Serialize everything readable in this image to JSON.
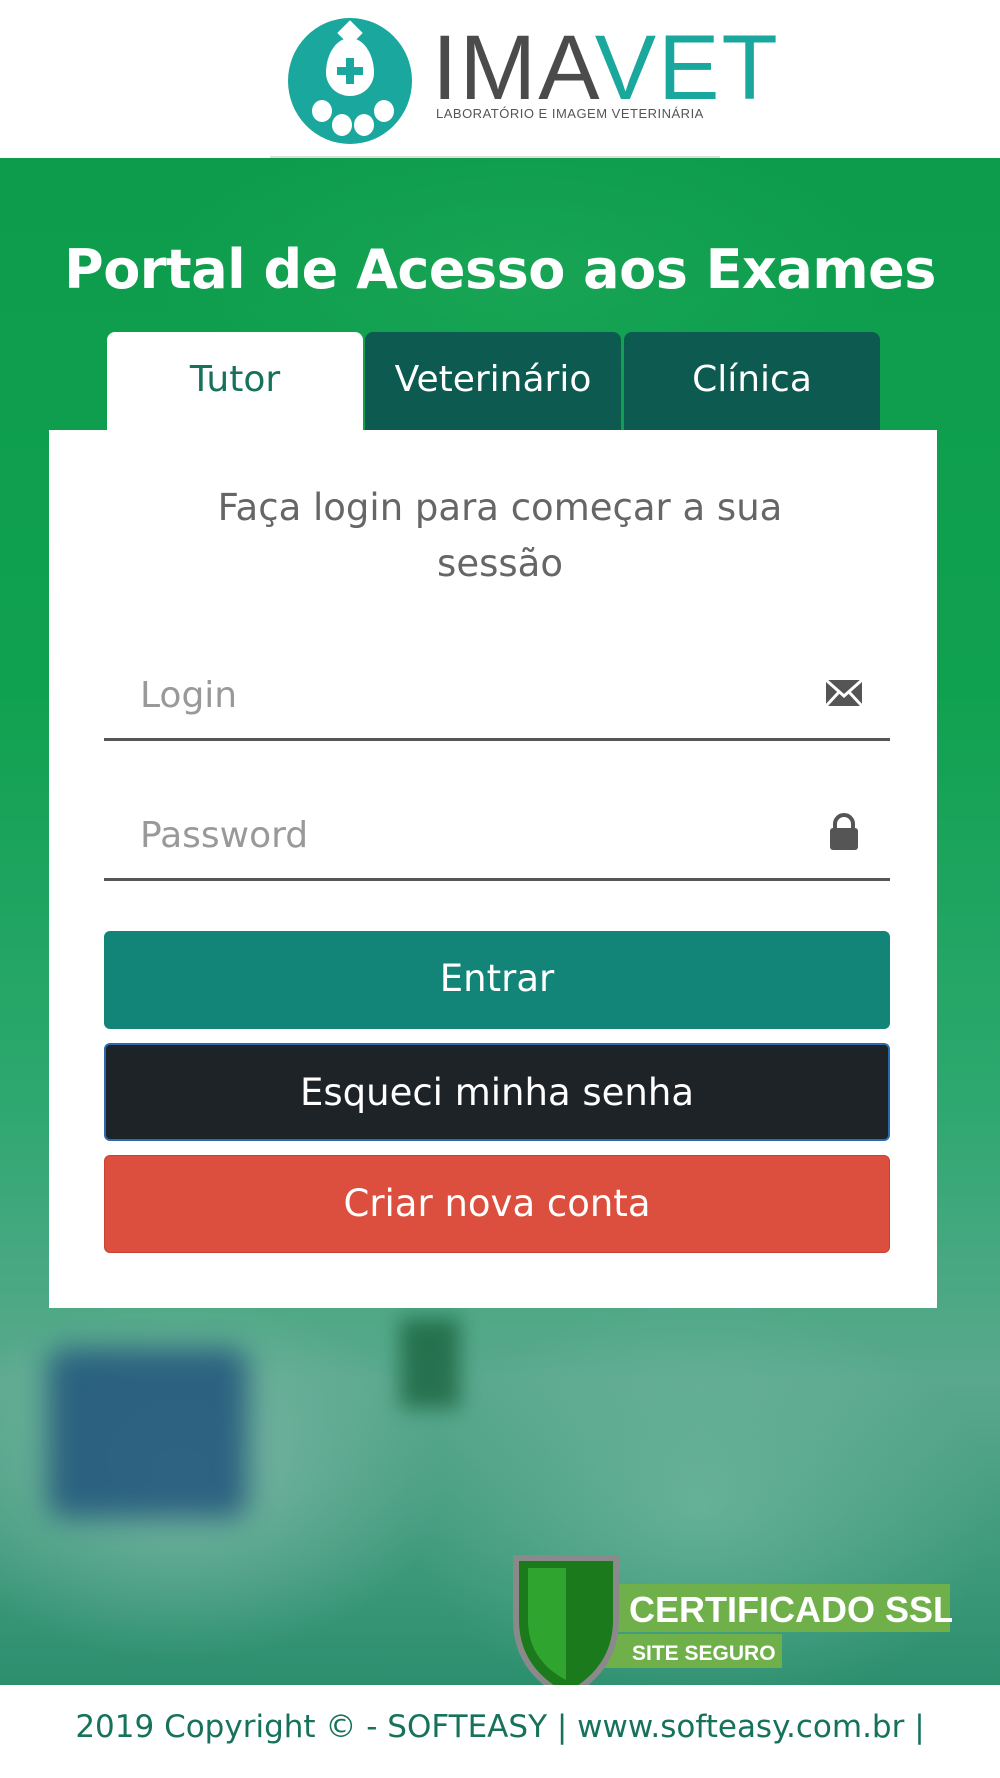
{
  "brand": {
    "name_part1": "IMA",
    "name_part2": "VET",
    "tagline": "LABORATÓRIO E IMAGEM VETERINÁRIA",
    "primary_color": "#1aa79d"
  },
  "page": {
    "title": "Portal de Acesso aos Exames",
    "subtitle": "Faça login para começar a sua sessão"
  },
  "tabs": [
    {
      "label": "Tutor",
      "active": true
    },
    {
      "label": "Veterinário",
      "active": false
    },
    {
      "label": "Clínica",
      "active": false
    }
  ],
  "form": {
    "login": {
      "placeholder": "Login",
      "value": "",
      "icon": "envelope-icon"
    },
    "password": {
      "placeholder": "Password",
      "value": "",
      "icon": "lock-icon"
    }
  },
  "buttons": {
    "enter": "Entrar",
    "forgot": "Esqueci minha senha",
    "create": "Criar nova conta"
  },
  "ssl_badge": {
    "title": "CERTIFICADO SSL",
    "subtitle": "SITE SEGURO"
  },
  "footer": {
    "text": "2019 Copyright © - SOFTEASY | www.softeasy.com.br |"
  },
  "colors": {
    "tab_active_text": "#17725c",
    "tab_inactive_bg": "#0d5a50",
    "enter_bg": "#138578",
    "forgot_bg": "#1e2328",
    "create_bg": "#dc4e3d",
    "hero_green": "#10a150"
  }
}
